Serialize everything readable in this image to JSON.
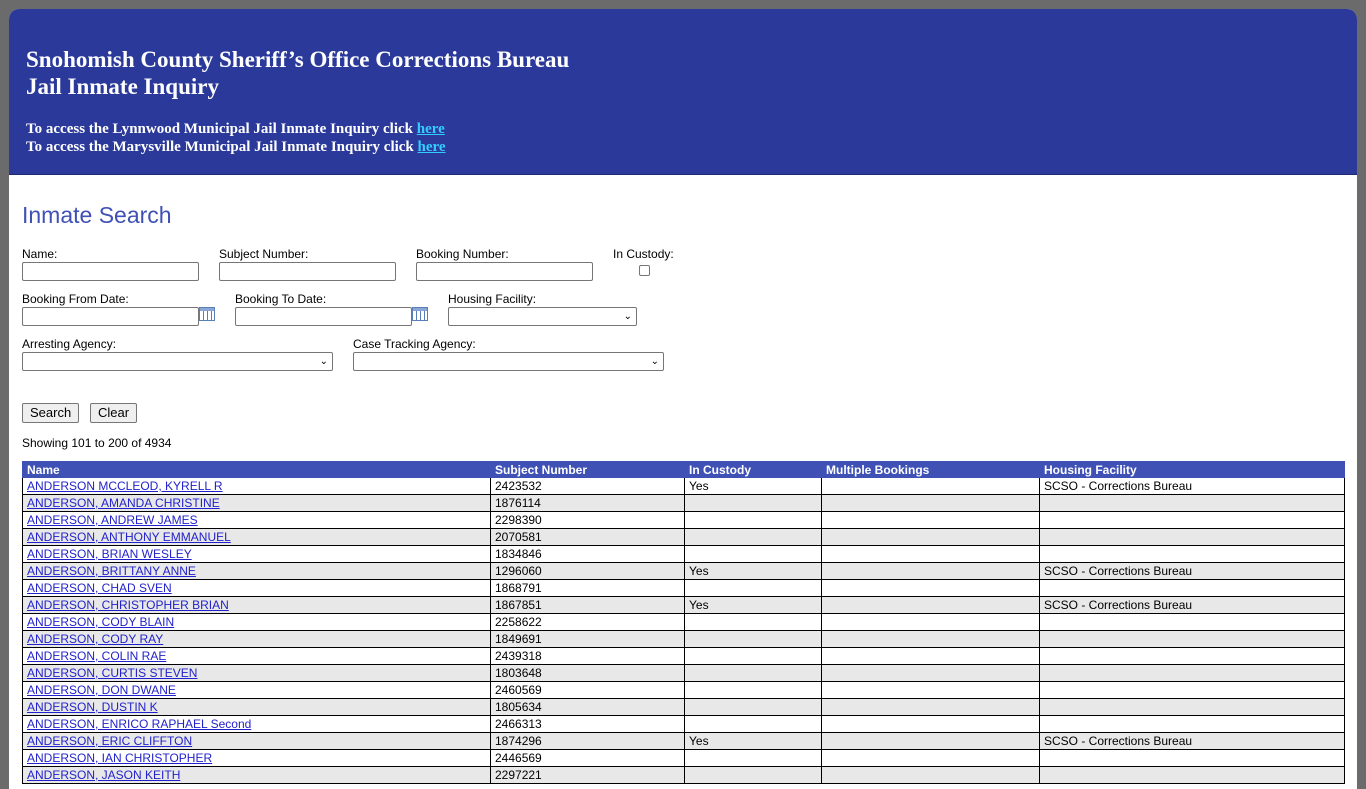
{
  "header": {
    "title_line1": "Snohomish County Sheriff’s Office Corrections Bureau",
    "title_line2": "Jail Inmate Inquiry",
    "link1_prefix": "To access the Lynnwood Municipal Jail Inmate Inquiry click ",
    "link1_text": "here",
    "link2_prefix": "To access the Marysville Municipal Jail Inmate Inquiry click ",
    "link2_text": "here"
  },
  "search": {
    "heading": "Inmate Search",
    "name_label": "Name:",
    "name_value": "",
    "subject_label": "Subject Number:",
    "subject_value": "",
    "booking_label": "Booking Number:",
    "booking_value": "",
    "custody_label": "In Custody:",
    "from_label": "Booking From Date:",
    "from_value": "",
    "to_label": "Booking To Date:",
    "to_value": "",
    "housing_label": "Housing Facility:",
    "housing_value": "",
    "arresting_label": "Arresting Agency:",
    "arresting_value": "",
    "case_label": "Case Tracking Agency:",
    "case_value": "",
    "search_button": "Search",
    "clear_button": "Clear",
    "showing": "Showing 101 to 200 of 4934"
  },
  "results": {
    "columns": [
      "Name",
      "Subject Number",
      "In Custody",
      "Multiple Bookings",
      "Housing Facility"
    ],
    "rows": [
      [
        "ANDERSON MCCLEOD, KYRELL R",
        "2423532",
        "Yes",
        "",
        "SCSO - Corrections Bureau"
      ],
      [
        "ANDERSON, AMANDA CHRISTINE",
        "1876114",
        "",
        "",
        ""
      ],
      [
        "ANDERSON, ANDREW JAMES",
        "2298390",
        "",
        "",
        ""
      ],
      [
        "ANDERSON, ANTHONY EMMANUEL",
        "2070581",
        "",
        "",
        ""
      ],
      [
        "ANDERSON, BRIAN WESLEY",
        "1834846",
        "",
        "",
        ""
      ],
      [
        "ANDERSON, BRITTANY ANNE",
        "1296060",
        "Yes",
        "",
        "SCSO - Corrections Bureau"
      ],
      [
        "ANDERSON, CHAD SVEN",
        "1868791",
        "",
        "",
        ""
      ],
      [
        "ANDERSON, CHRISTOPHER BRIAN",
        "1867851",
        "Yes",
        "",
        "SCSO - Corrections Bureau"
      ],
      [
        "ANDERSON, CODY BLAIN",
        "2258622",
        "",
        "",
        ""
      ],
      [
        "ANDERSON, CODY RAY",
        "1849691",
        "",
        "",
        ""
      ],
      [
        "ANDERSON, COLIN RAE",
        "2439318",
        "",
        "",
        ""
      ],
      [
        "ANDERSON, CURTIS STEVEN",
        "1803648",
        "",
        "",
        ""
      ],
      [
        "ANDERSON, DON DWANE",
        "2460569",
        "",
        "",
        ""
      ],
      [
        "ANDERSON, DUSTIN K",
        "1805634",
        "",
        "",
        ""
      ],
      [
        "ANDERSON, ENRICO RAPHAEL Second",
        "2466313",
        "",
        "",
        ""
      ],
      [
        "ANDERSON, ERIC CLIFFTON",
        "1874296",
        "Yes",
        "",
        "SCSO - Corrections Bureau"
      ],
      [
        "ANDERSON, IAN CHRISTOPHER",
        "2446569",
        "",
        "",
        ""
      ],
      [
        "ANDERSON, JASON KEITH",
        "2297221",
        "",
        "",
        ""
      ]
    ]
  }
}
